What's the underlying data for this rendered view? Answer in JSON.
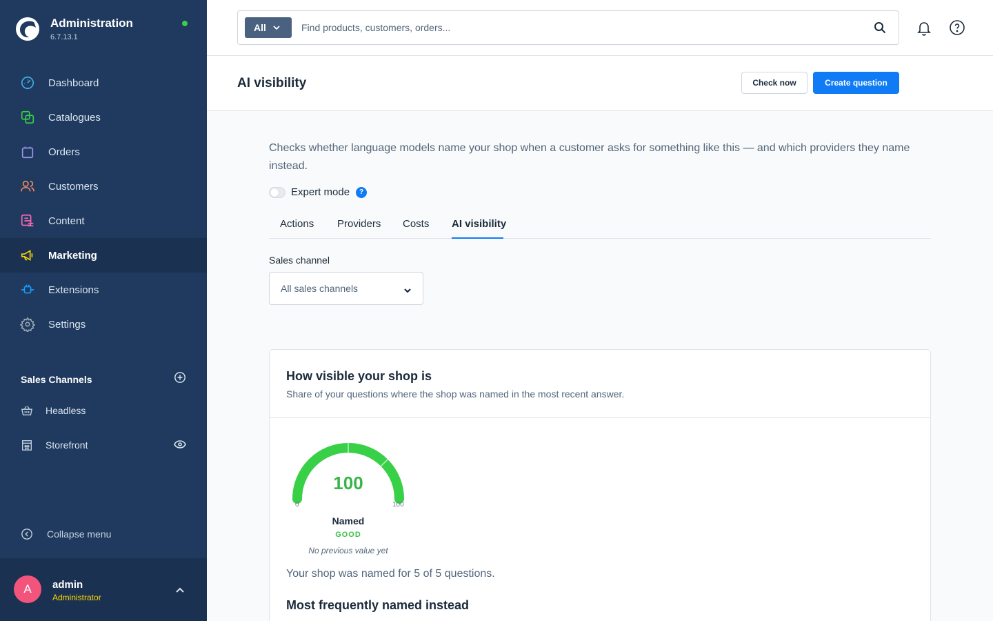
{
  "brand": {
    "title": "Administration",
    "version": "6.7.13.1"
  },
  "nav": {
    "items": [
      {
        "label": "Dashboard",
        "icon": "dashboard-icon",
        "color": "#3db0ea"
      },
      {
        "label": "Catalogues",
        "icon": "catalogue-icon",
        "color": "#37d046"
      },
      {
        "label": "Orders",
        "icon": "orders-bag-icon",
        "color": "#a092f0"
      },
      {
        "label": "Customers",
        "icon": "customers-icon",
        "color": "#f88962"
      },
      {
        "label": "Content",
        "icon": "content-icon",
        "color": "#ff68b4"
      },
      {
        "label": "Marketing",
        "icon": "megaphone-icon",
        "color": "#ffd700"
      },
      {
        "label": "Extensions",
        "icon": "plug-icon",
        "color": "#189eff"
      },
      {
        "label": "Settings",
        "icon": "gear-icon",
        "color": "#9aa8b5"
      }
    ],
    "active": "Marketing"
  },
  "sales_channels": {
    "title": "Sales Channels",
    "items": [
      {
        "label": "Headless",
        "icon": "basket-icon"
      },
      {
        "label": "Storefront",
        "icon": "storefront-icon"
      }
    ]
  },
  "collapse_label": "Collapse menu",
  "user": {
    "initial": "A",
    "name": "admin",
    "role": "Administrator"
  },
  "search": {
    "type_label": "All",
    "placeholder": "Find products, customers, orders..."
  },
  "page": {
    "title": "AI visibility",
    "check_now_label": "Check now",
    "create_question_label": "Create question",
    "description": "Checks whether language models name your shop when a customer asks for something like this — and which providers they name instead.",
    "expert_mode_label": "Expert mode",
    "tabs": [
      "Actions",
      "Providers",
      "Costs",
      "AI visibility"
    ],
    "active_tab": "AI visibility",
    "sales_channel_label": "Sales channel",
    "sales_channel_value": "All sales channels"
  },
  "card": {
    "title": "How visible your shop is",
    "subtitle": "Share of your questions where the shop was named in the most recent answer.",
    "gauge": {
      "value": "100",
      "min": "0",
      "max": "100",
      "fraction": 1.0
    },
    "metric_name": "Named",
    "rating": "GOOD",
    "previous": "No previous value yet",
    "summary": "Your shop was named for 5 of 5 questions.",
    "subheading": "Most frequently named instead"
  },
  "colors": {
    "sidebar": "#1f3a5e",
    "primary": "#0f7cf5",
    "good": "#37c04b",
    "online": "#37d046"
  }
}
